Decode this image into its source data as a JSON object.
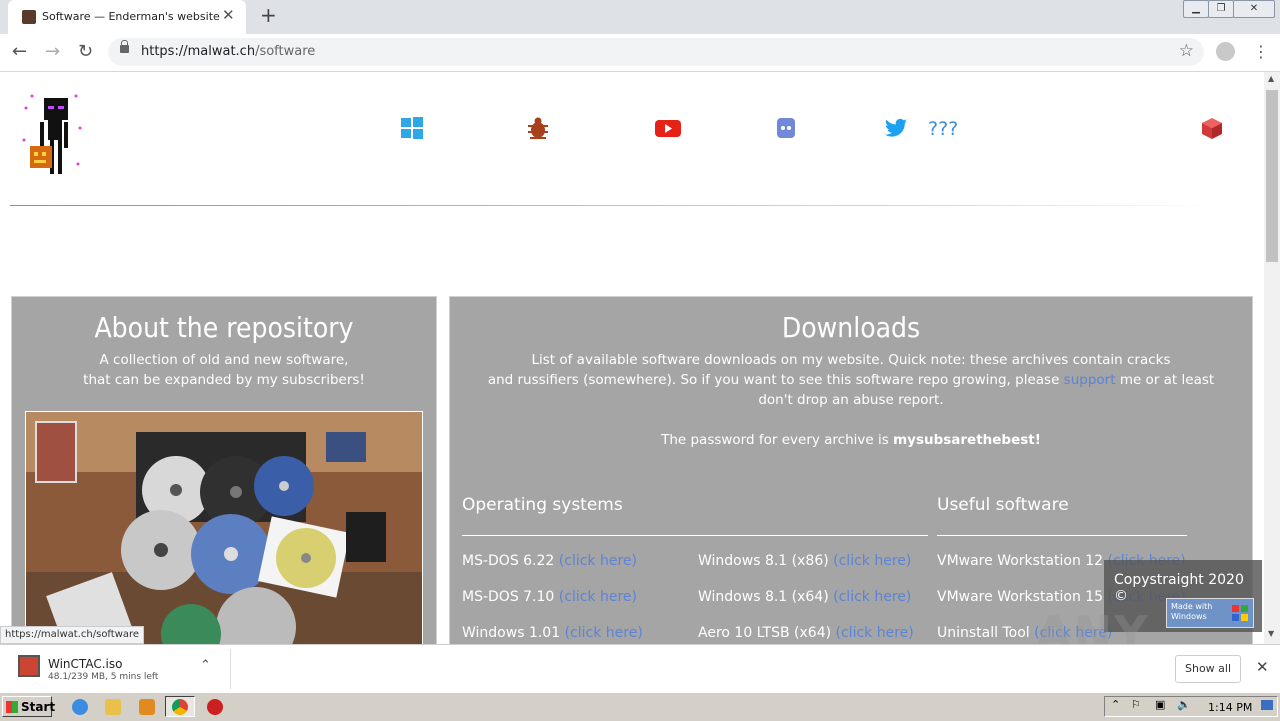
{
  "browser": {
    "tab_title": "Software — Enderman's website",
    "url_host": "https://malwat.ch",
    "url_path": "/software",
    "status_url": "https://malwat.ch/software"
  },
  "nav": {
    "icons": [
      "windows-icon",
      "bug-icon",
      "youtube-icon",
      "discord-icon",
      "twitter-icon",
      "cube-icon"
    ],
    "questions": "???"
  },
  "about": {
    "title": "About the repository",
    "line1": "A collection of old and new software,",
    "line2": "that can be expanded by my subscribers!"
  },
  "downloads": {
    "title": "Downloads",
    "intro1": "List of available software downloads on my website. Quick note: these archives contain cracks",
    "intro2a": "and russifiers (somewhere). So if you want to see this software repo growing, please",
    "intro2_link": "support",
    "intro2b": "me or at least",
    "intro3": "don't drop an abuse report.",
    "password_prefix": "The password for every archive is",
    "password": "mysubsarethebest!",
    "os_heading": "Operating systems",
    "useful_heading": "Useful software",
    "link_text": "(click here)",
    "os_col1": [
      "MS-DOS 6.22",
      "MS-DOS 7.10",
      "Windows 1.01"
    ],
    "os_col2": [
      "Windows 8.1 (x86)",
      "Windows 8.1 (x64)",
      "Aero 10 LTSB (x64)"
    ],
    "useful": [
      "VMware Workstation 12",
      "VMware Workstation 15",
      "Uninstall Tool"
    ]
  },
  "overlay": {
    "copyright": "Copystraight 2020 ©",
    "made_with": "Made with",
    "windows": "Windows"
  },
  "watermark": "ANY RUN",
  "download_shelf": {
    "file_name": "WinCTAC.iso",
    "progress": "48.1/239 MB, 5 mins left",
    "show_all": "Show all"
  },
  "taskbar": {
    "start": "Start",
    "clock": "1:14 PM"
  }
}
